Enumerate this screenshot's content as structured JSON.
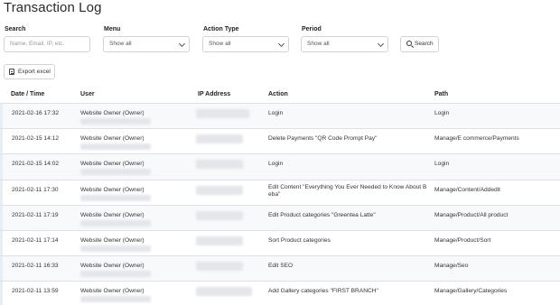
{
  "page": {
    "title": "Transaction Log"
  },
  "filters": {
    "search_label": "Search",
    "search_placeholder": "Name, Email, IP, etc.",
    "menu_label": "Menu",
    "menu_value": "Show all",
    "action_type_label": "Action Type",
    "action_type_value": "Show all",
    "period_label": "Period",
    "period_value": "Show all",
    "search_button": "Search"
  },
  "export_button": "Export excel",
  "table": {
    "headers": {
      "date": "Date / Time",
      "user": "User",
      "ip": "IP Address",
      "action": "Action",
      "path": "Path"
    },
    "rows": [
      {
        "date": "2021-02-16 17:32",
        "user": "Website Owner (Owner)",
        "action": "Login",
        "path": "Login"
      },
      {
        "date": "2021-02-15 14:12",
        "user": "Website Owner (Owner)",
        "action": "Delete Payments \"QR Code Prompt Pay\"",
        "path": "Manage/E commerce/Payments"
      },
      {
        "date": "2021-02-15 14:02",
        "user": "Website Owner (Owner)",
        "action": "Login",
        "path": "Login"
      },
      {
        "date": "2021-02-11 17:30",
        "user": "Website Owner (Owner)",
        "action": "Edit Content \"Everything You Ever Needed to Know About B eba\"",
        "path": "Manage/Content/Addedit"
      },
      {
        "date": "2021-02-11 17:19",
        "user": "Website Owner (Owner)",
        "action": "Edit Product categories \"Greentea Latte\"",
        "path": "Manage/Product/All product"
      },
      {
        "date": "2021-02-11 17:14",
        "user": "Website Owner (Owner)",
        "action": "Sort Product categories",
        "path": "Manage/Product/Sort"
      },
      {
        "date": "2021-02-11 16:33",
        "user": "Website Owner (Owner)",
        "action": "Edit SEO",
        "path": "Manage/Seo"
      },
      {
        "date": "2021-02-11 13:59",
        "user": "Website Owner (Owner)",
        "action": "Add Gallery categories \"FIRST BRANCH\"",
        "path": "Manage/Gallery/Categories"
      }
    ]
  }
}
